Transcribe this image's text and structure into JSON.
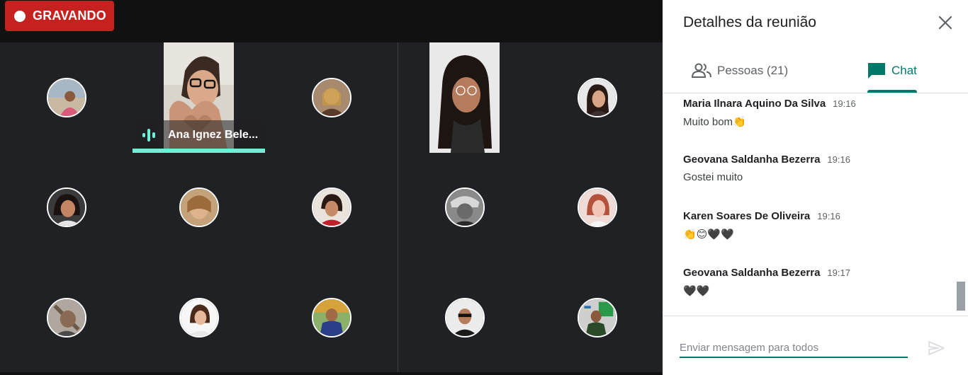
{
  "recording": {
    "label": "GRAVANDO"
  },
  "main_video": {
    "speaker_name": "Ana Ignez Bele..."
  },
  "panel": {
    "title": "Detalhes da reunião",
    "tabs": [
      {
        "label": "Pessoas (21)",
        "icon": "people-icon"
      },
      {
        "label": "Chat",
        "icon": "chat-icon",
        "active": true
      }
    ]
  },
  "messages": [
    {
      "sender": "Maria Ilnara Aquino Da Silva",
      "time": "19:16",
      "text": "Muito bom👏"
    },
    {
      "sender": "Geovana Saldanha Bezerra",
      "time": "19:16",
      "text": "Gostei muito"
    },
    {
      "sender": "Karen Soares De Oliveira",
      "time": "19:16",
      "text": "👏😊🖤🖤"
    },
    {
      "sender": "Geovana Saldanha Bezerra",
      "time": "19:17",
      "text": "🖤🖤"
    }
  ],
  "composer": {
    "placeholder": "Enviar mensagem para todos"
  },
  "colors": {
    "accent": "#00796b",
    "recording": "#c5221f",
    "speaking": "#6ef0d6",
    "background": "#202124"
  }
}
